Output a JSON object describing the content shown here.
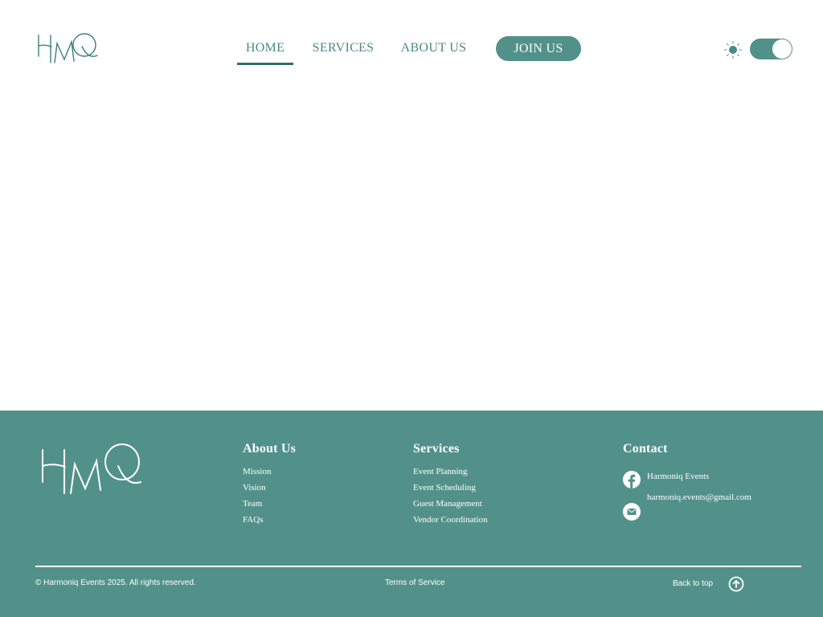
{
  "header": {
    "logo_text": "HMQ",
    "nav": [
      {
        "label": "HOME",
        "active": true
      },
      {
        "label": "SERVICES",
        "active": false
      },
      {
        "label": "ABOUT US",
        "active": false
      }
    ],
    "join_label": "JOIN US",
    "theme_toggle": {
      "icon": "sun-icon",
      "state": "on"
    }
  },
  "footer": {
    "logo_text": "HMQ",
    "about": {
      "heading": "About Us",
      "links": [
        "Mission",
        "Vision",
        "Team",
        "FAQs"
      ]
    },
    "services": {
      "heading": "Services",
      "links": [
        "Event Planning",
        "Event Scheduling",
        "Guest Management",
        "Vendor Coordination"
      ]
    },
    "contact": {
      "heading": "Contact",
      "facebook": {
        "icon": "facebook-icon",
        "label": "Harmoniq Events"
      },
      "email": {
        "icon": "mail-icon",
        "label": "harmoniq.events@gmail.com"
      }
    },
    "copyright": "© Harmoniq Events 2025. All rights reserved.",
    "terms": "Terms of Service",
    "back_to_top": {
      "label": "Back to top",
      "icon": "arrow-up-circle-icon"
    }
  },
  "colors": {
    "brand": "#52918a",
    "brand_dark": "#2f6e69",
    "nav_text": "#4a8a85",
    "background": "#ffffff"
  }
}
